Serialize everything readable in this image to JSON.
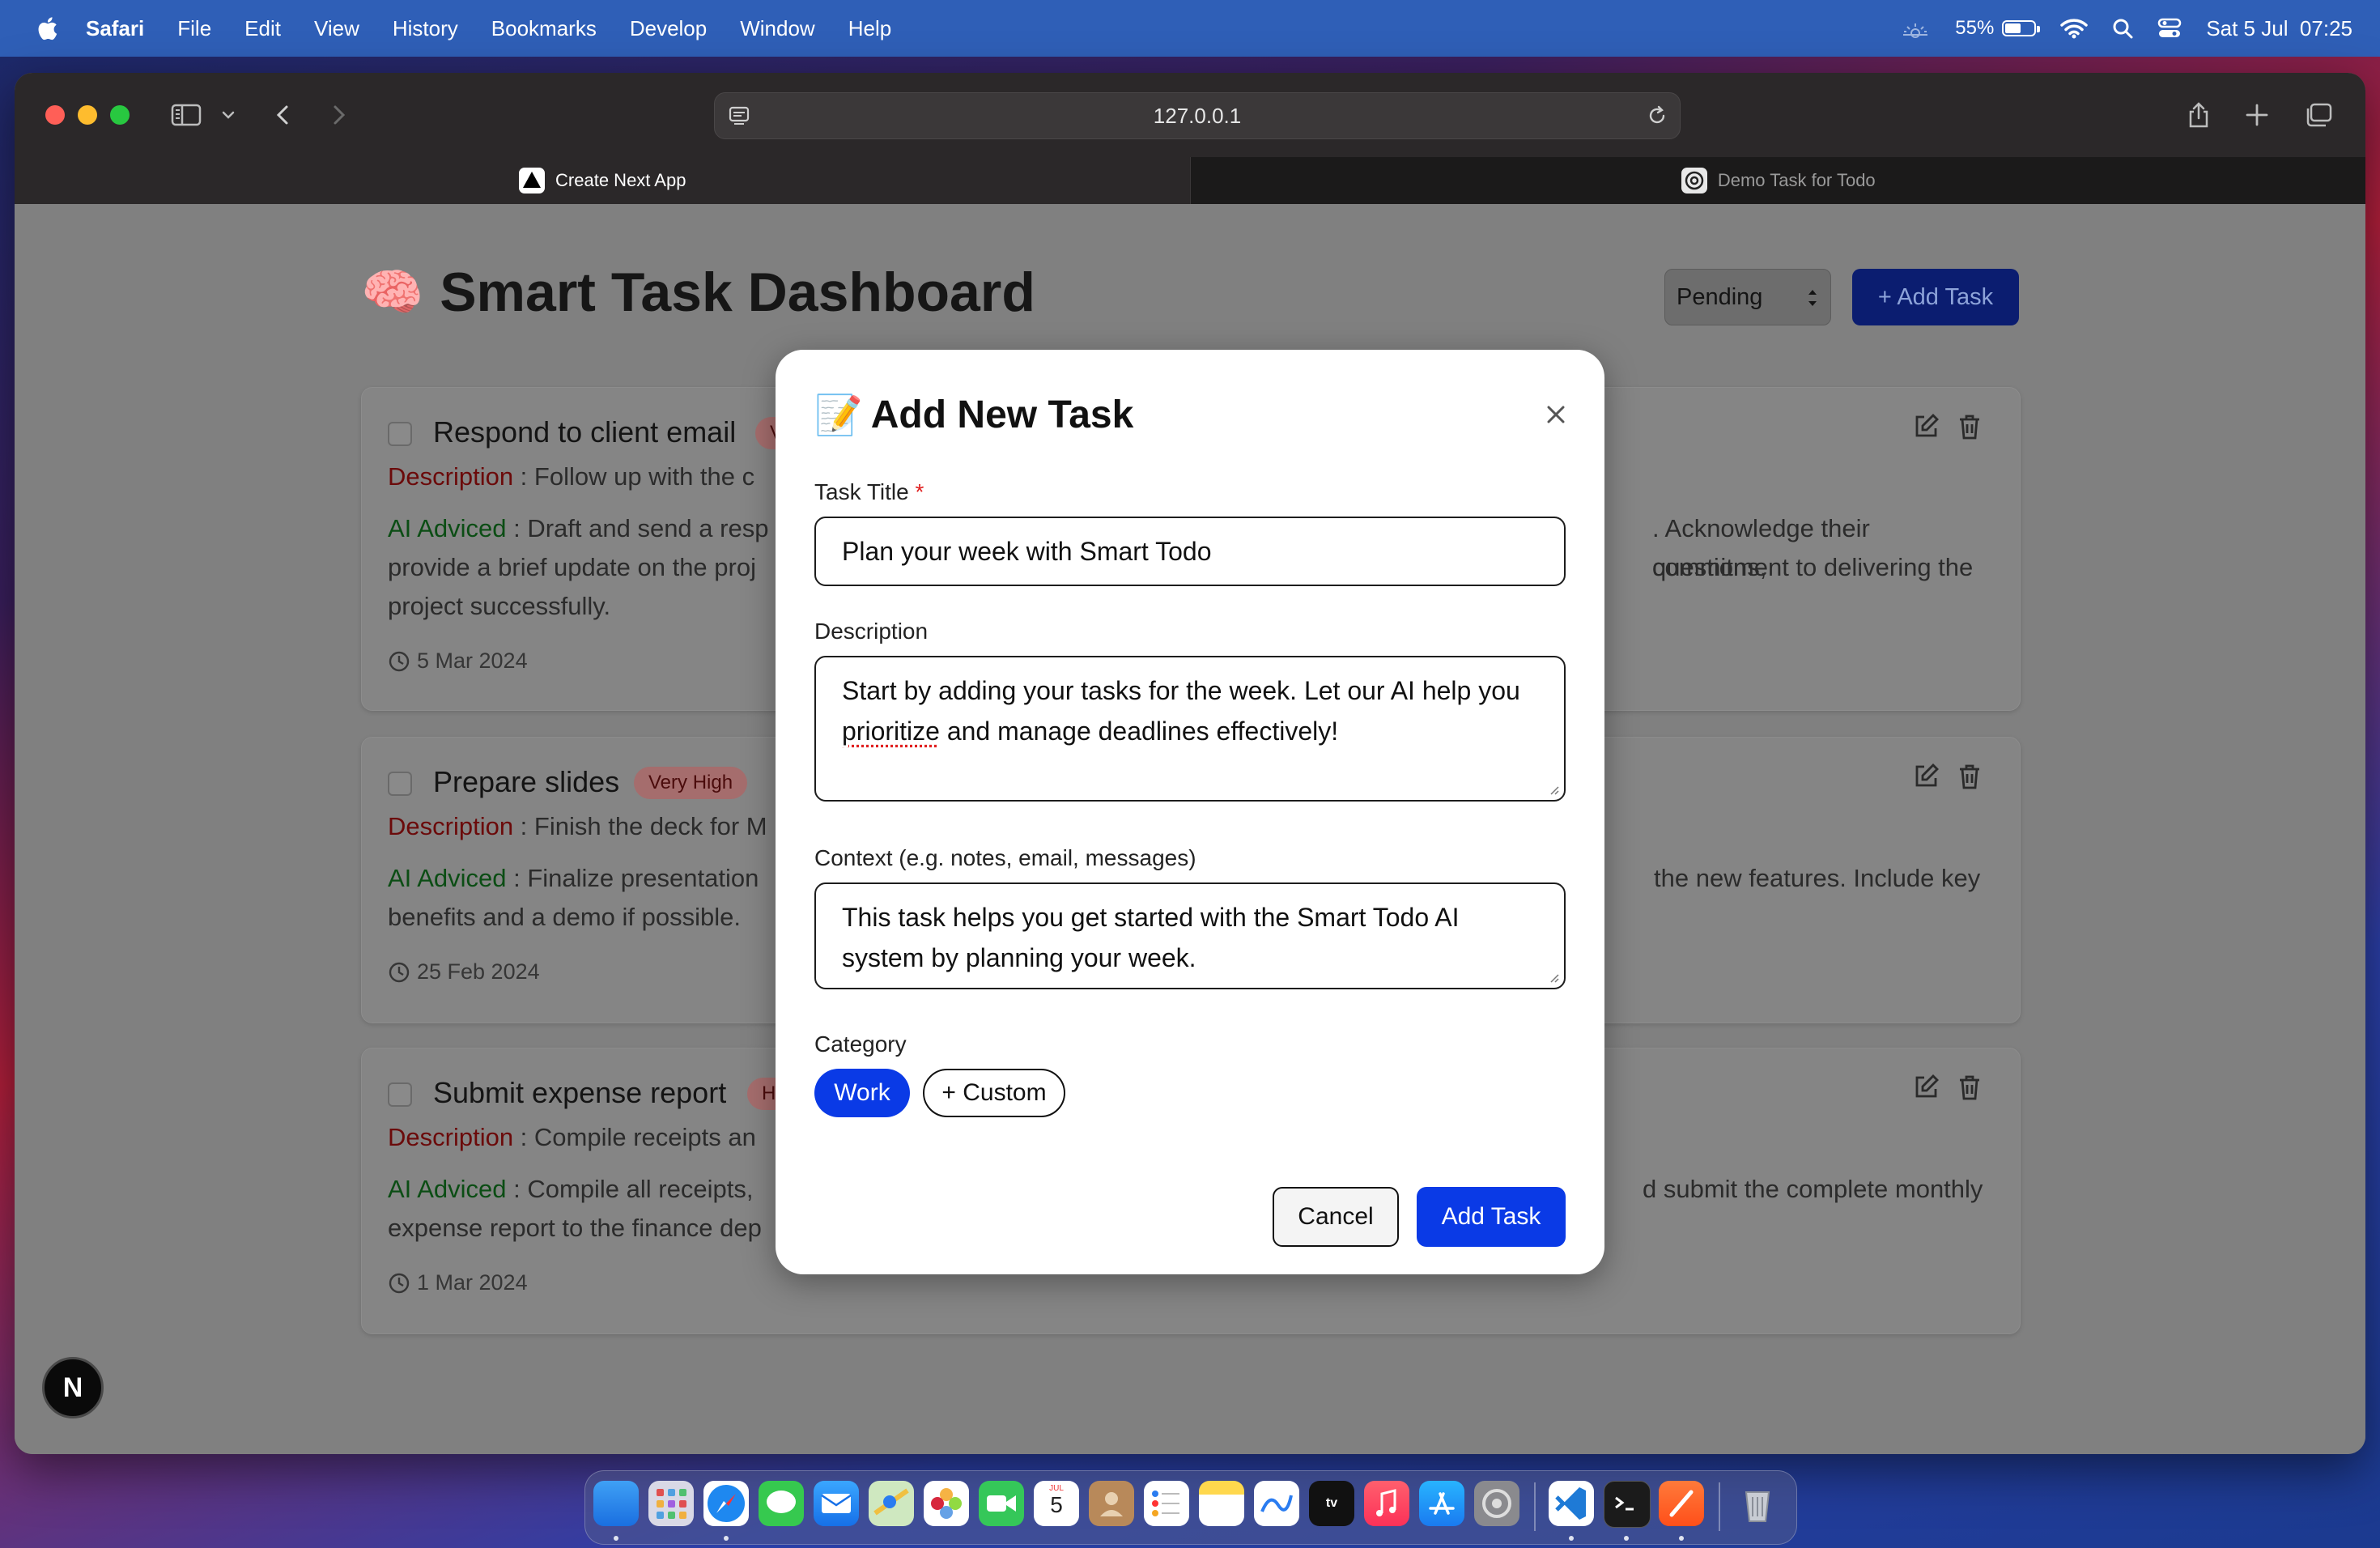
{
  "menubar": {
    "app_name": "Safari",
    "menus": [
      "File",
      "Edit",
      "View",
      "History",
      "Bookmarks",
      "Develop",
      "Window",
      "Help"
    ],
    "battery_percent": "55%",
    "battery_level": 0.55,
    "datetime": "Sat 5 Jul  07:25"
  },
  "browser": {
    "url": "127.0.0.1",
    "tabs": [
      {
        "title": "Create Next App",
        "active": true,
        "icon": "nextjs-icon"
      },
      {
        "title": "Demo Task for Todo",
        "active": false,
        "icon": "openai-icon"
      }
    ]
  },
  "dashboard": {
    "title_emoji": "🧠",
    "title": "Smart Task Dashboard",
    "filter_selected": "Pending",
    "add_task_label": "+ Add Task"
  },
  "tasks": [
    {
      "title": "Respond to client email",
      "priority": "V",
      "description_label": "Description",
      "description": " : Follow up with the c",
      "ai_label": "AI Adviced",
      "ai_advice_left": " : Draft and send a resp",
      "ai_advice_right": ". Acknowledge their questions,",
      "ai_line2_left": "provide a brief update on the proj",
      "ai_line2_right": "commitment to delivering the",
      "ai_line3_left": "project successfully.",
      "date": "5 Mar 2024"
    },
    {
      "title": "Prepare slides",
      "priority": "Very High",
      "description_label": "Description",
      "description": " : Finish the deck for M",
      "ai_label": "AI Adviced",
      "ai_advice_left": " : Finalize presentation",
      "ai_advice_right": "the new features. Include key",
      "ai_line2_left": "benefits and a demo if possible.",
      "date": "25 Feb 2024"
    },
    {
      "title": "Submit expense report",
      "priority": "H",
      "description_label": "Description",
      "description": " : Compile receipts an",
      "ai_label": "AI Adviced",
      "ai_advice_left": " : Compile all receipts,",
      "ai_advice_right": "d submit the complete monthly",
      "ai_line2_left": "expense report to the finance dep",
      "date": "1 Mar 2024"
    }
  ],
  "modal": {
    "emoji": "📝",
    "title": "Add New Task",
    "title_label": "Task Title",
    "required_mark": "*",
    "title_value": "Plan your week with Smart Todo",
    "description_label": "Description",
    "description_value_part1": "Start by adding your tasks for the week. Let our AI help you ",
    "description_value_misspelled": "prioritize",
    "description_value_part2": " and manage deadlines effectively!",
    "context_label": "Context (e.g. notes, email, messages)",
    "context_value": "This task helps you get started with the Smart Todo AI system by planning your week.",
    "category_label": "Category",
    "categories": [
      "Work",
      "+ Custom"
    ],
    "selected_category": "Work",
    "cancel_label": "Cancel",
    "submit_label": "Add Task"
  },
  "devtools_badge": "N",
  "dock": {
    "apps": [
      "Finder",
      "Launchpad",
      "Safari",
      "Messages",
      "Mail",
      "Maps",
      "Photos",
      "FaceTime",
      "Calendar",
      "Contacts",
      "Reminders",
      "Notes",
      "Freeform",
      "TV",
      "Music",
      "App Store",
      "System Settings",
      "Visual Studio Code",
      "Terminal",
      "Sublime",
      "Trash"
    ],
    "calendar_month": "JUL",
    "calendar_day": "5"
  }
}
